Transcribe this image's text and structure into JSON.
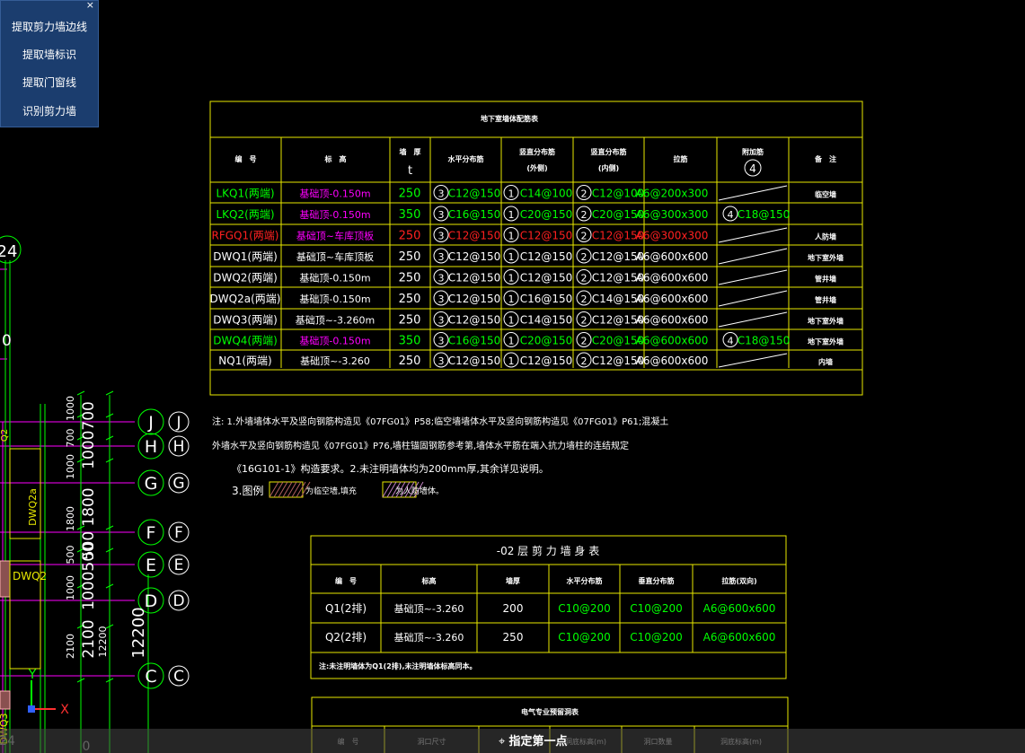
{
  "panel": {
    "close": "×",
    "buttons": [
      "提取剪力墙边线",
      "提取墙标识",
      "提取门窗线",
      "识别剪力墙"
    ]
  },
  "status": {
    "command": "指定第一点"
  },
  "table1": {
    "title": "地下室墙体配筋表",
    "headers": [
      [
        "编　号",
        ""
      ],
      [
        "标　高",
        ""
      ],
      [
        "墙　厚",
        "t"
      ],
      [
        "水平分布筋",
        ""
      ],
      [
        "竖直分布筋",
        "(外侧)"
      ],
      [
        "竖直分布筋",
        "(内侧)"
      ],
      [
        "拉筋",
        ""
      ],
      [
        "附加筋",
        "4"
      ],
      [
        "备　注",
        ""
      ]
    ],
    "rows": [
      {
        "id": "LKQ1(两端)",
        "elev": "基础顶-0.150m",
        "t": "250",
        "h": "C12@150",
        "vo": "C14@100",
        "vi": "C12@100",
        "tie": "A6@200x300",
        "add": "",
        "note": "临空墙",
        "color": "#00ff00",
        "ecolor": "#ff00ff"
      },
      {
        "id": "LKQ2(两端)",
        "elev": "基础顶-0.150m",
        "t": "350",
        "h": "C16@150",
        "vo": "C20@150",
        "vi": "C20@150",
        "tie": "A6@300x300",
        "add": "C18@150",
        "note": "",
        "color": "#00ff00",
        "ecolor": "#ff00ff"
      },
      {
        "id": "RFGQ1(两端)",
        "elev": "基础顶~车库顶板",
        "t": "250",
        "h": "C12@150",
        "vo": "C12@150",
        "vi": "C12@150",
        "tie": "A6@300x300",
        "add": "",
        "note": "人防墙",
        "color": "#ff2020",
        "ecolor": "#ff00ff"
      },
      {
        "id": "DWQ1(两端)",
        "elev": "基础顶~车库顶板",
        "t": "250",
        "h": "C12@150",
        "vo": "C12@150",
        "vi": "C12@150",
        "tie": "A6@600x600",
        "add": "",
        "note": "地下室外墙",
        "color": "#ffffff",
        "ecolor": "#ffffff"
      },
      {
        "id": "DWQ2(两端)",
        "elev": "基础顶-0.150m",
        "t": "250",
        "h": "C12@150",
        "vo": "C12@150",
        "vi": "C12@150",
        "tie": "A6@600x600",
        "add": "",
        "note": "管井墙",
        "color": "#ffffff",
        "ecolor": "#ffffff"
      },
      {
        "id": "DWQ2a(两端)",
        "elev": "基础顶-0.150m",
        "t": "250",
        "h": "C12@150",
        "vo": "C16@150",
        "vi": "C14@150",
        "tie": "A6@600x600",
        "add": "",
        "note": "管井墙",
        "color": "#ffffff",
        "ecolor": "#ffffff"
      },
      {
        "id": "DWQ3(两端)",
        "elev": "基础顶~-3.260m",
        "t": "250",
        "h": "C12@150",
        "vo": "C14@150",
        "vi": "C12@150",
        "tie": "A6@600x600",
        "add": "",
        "note": "地下室外墙",
        "color": "#ffffff",
        "ecolor": "#ffffff"
      },
      {
        "id": "DWQ4(两端)",
        "elev": "基础顶-0.150m",
        "t": "350",
        "h": "C16@150",
        "vo": "C20@150",
        "vi": "C20@150",
        "tie": "A6@600x600",
        "add": "C18@150",
        "note": "地下室外墙",
        "color": "#00ff00",
        "ecolor": "#ff00ff"
      },
      {
        "id": "NQ1(两端)",
        "elev": "基础顶~-3.260",
        "t": "250",
        "h": "C12@150",
        "vo": "C12@150",
        "vi": "C12@150",
        "tie": "A6@600x600",
        "add": "",
        "note": "内墙",
        "color": "#ffffff",
        "ecolor": "#ffffff"
      }
    ],
    "bar_nums": {
      "h": "3",
      "vo": "1",
      "vi": "2",
      "add": "4"
    }
  },
  "notes": {
    "line1": "注: 1.外墙墙体水平及竖向钢筋构造见《07FG01》P58;临空墙墙体水平及竖向钢筋构造见《07FG01》P61;混凝土",
    "line2": "外墙水平及竖向钢筋构造见《07FG01》P76,墙柱锚固钢筋参考第,墙体水平筋在端入抗力墙柱的连结规定",
    "line3": "《16G101-1》构造要求。2.未注明墙体均为200mm厚,其余详见说明。",
    "line4": "3.图例",
    "legend1": "为临空墙,填充",
    "legend2": "为人防墙体。"
  },
  "table2": {
    "title": "-02 层 剪 力 墙 身 表",
    "headers": [
      "编　号",
      "标高",
      "墙厚",
      "水平分布筋",
      "垂直分布筋",
      "拉筋(双向)"
    ],
    "rows": [
      [
        "Q1(2排)",
        "基础顶~-3.260",
        "200",
        "C10@200",
        "C10@200",
        "A6@600x600"
      ],
      [
        "Q2(2排)",
        "基础顶~-3.260",
        "250",
        "C10@200",
        "C10@200",
        "A6@600x600"
      ]
    ],
    "note": "注:未注明墙体为Q1(2排),未注明墙体标高同本。"
  },
  "table3": {
    "title": "电气专业预留洞表",
    "headers": [
      "编　号",
      "洞口尺寸",
      "洞底标高(m)",
      "洞口数量",
      "洞底标高(m)"
    ]
  },
  "axes": {
    "labels": [
      "J",
      "H",
      "G",
      "F",
      "E",
      "D",
      "C"
    ],
    "left_labels": [
      "24",
      "0",
      "24",
      "0"
    ],
    "dims_small": [
      "1000",
      "700",
      "1000",
      "1800",
      "500",
      "1000",
      "2100"
    ],
    "dims_large": [
      "1000700",
      "1800",
      "500",
      "1000500",
      "2100"
    ],
    "dim_total": "12200",
    "dim_total2": "12200",
    "wall_labels": [
      "DWQ2a",
      "DWQ2",
      "DWQ3",
      "Q2"
    ]
  },
  "ucs": {
    "x": "X",
    "y": "Y"
  }
}
